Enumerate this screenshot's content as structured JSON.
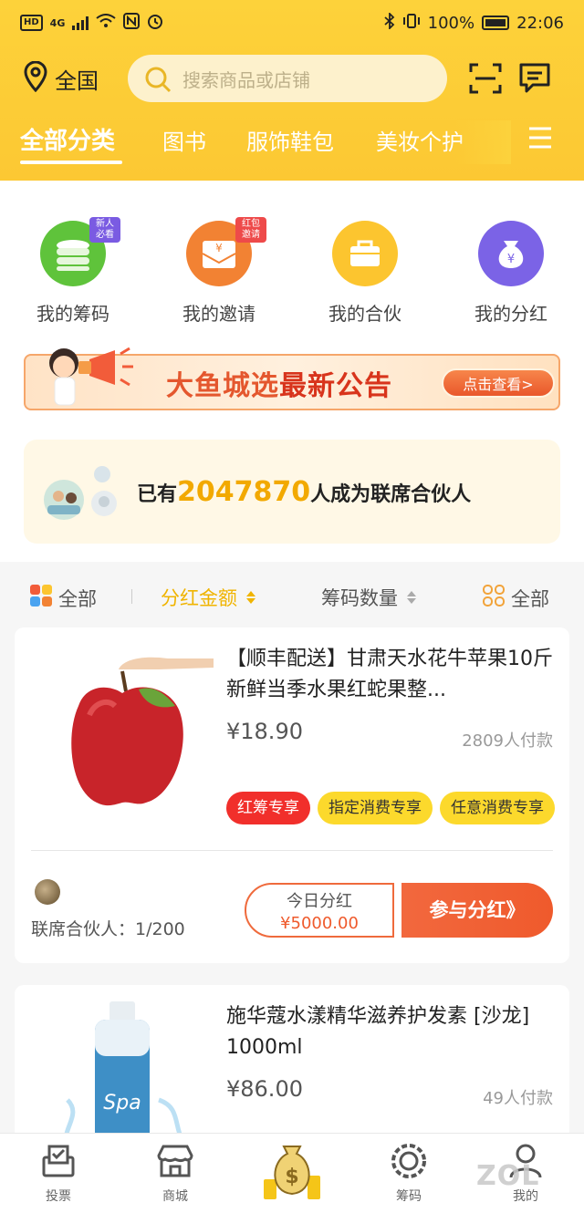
{
  "status_bar": {
    "left_chip_hd": "HD",
    "left_chip_4g": "4G",
    "battery_percent": "100%",
    "time": "22:06"
  },
  "header": {
    "location": "全国",
    "search_placeholder": "搜索商品或店铺",
    "tabs": [
      "全部分类",
      "图书",
      "服饰鞋包",
      "美妆个护"
    ],
    "active_tab_index": 0
  },
  "quick_links": [
    {
      "label": "我的筹码",
      "badge": "新人\n必看",
      "color": "#5fc33b"
    },
    {
      "label": "我的邀请",
      "badge": "红包\n邀请",
      "color": "#f28233"
    },
    {
      "label": "我的合伙",
      "badge": "",
      "color": "#fcc52f"
    },
    {
      "label": "我的分红",
      "badge": "",
      "color": "#7b63e6"
    }
  ],
  "banner": {
    "title_part1": "大鱼城选",
    "title_part2": "最新公告",
    "button": "点击查看>"
  },
  "partners": {
    "prefix": "已有",
    "count": "2047870",
    "suffix": "人成为联席合伙人"
  },
  "filter": {
    "all_left": "全部",
    "dividend_amount": "分红金额",
    "chip_count": "筹码数量",
    "all_right": "全部"
  },
  "products": [
    {
      "title": "【顺丰配送】甘肃天水花牛苹果10斤新鲜当季水果红蛇果整...",
      "price": "¥18.90",
      "payers": "2809人付款",
      "tags": [
        "红筹专享",
        "指定消费专享",
        "任意消费专享"
      ],
      "partner_ratio": "联席合伙人：1/200",
      "today_label": "今日分红",
      "today_value": "¥5000.00",
      "join_button": "参与分红》"
    },
    {
      "title": "施华蔻水漾精华滋养护发素 [沙龙] 1000ml",
      "price": "¥86.00",
      "payers": "49人付款"
    }
  ],
  "bottom_nav": [
    "投票",
    "商城",
    "",
    "筹码",
    "我的"
  ],
  "watermark": "ZOL",
  "colors": {
    "header_yellow": "#fcc833",
    "accent_orange": "#ef5a2c",
    "price_gold": "#f2a900"
  }
}
